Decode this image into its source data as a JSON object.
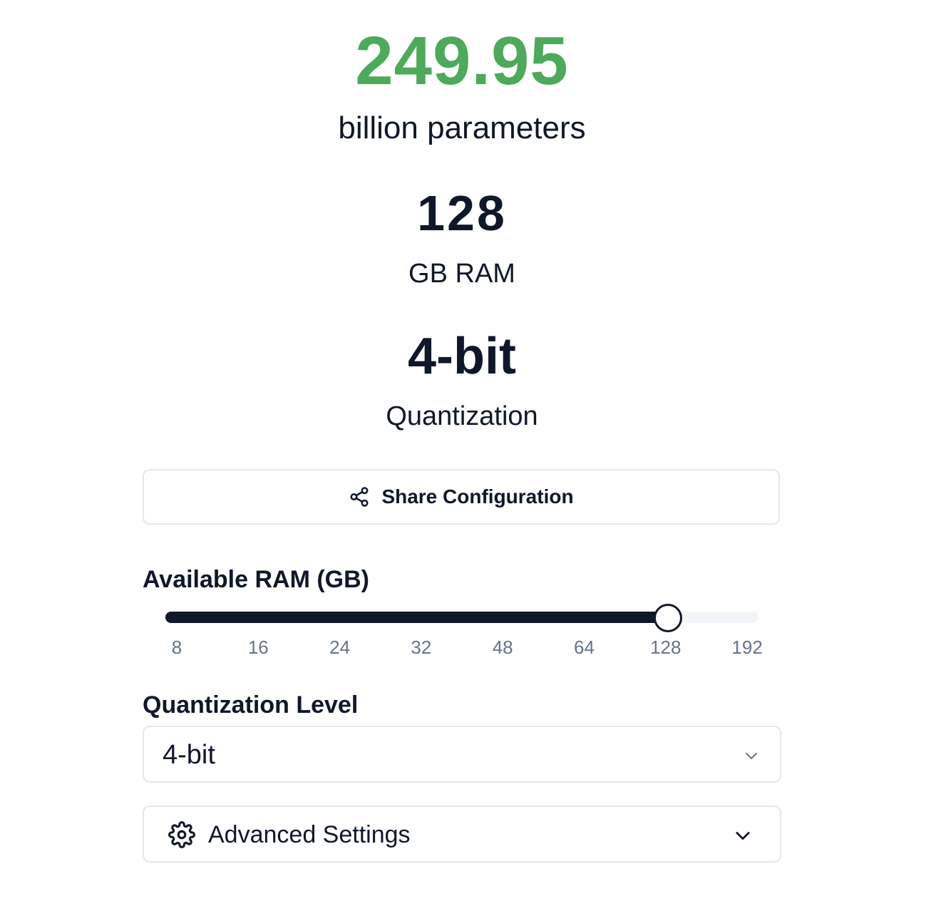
{
  "summary": {
    "parameters_value": "249.95",
    "parameters_caption": "billion parameters",
    "ram_value": "128",
    "ram_caption": "GB RAM",
    "quantization_value": "4-bit",
    "quantization_caption": "Quantization"
  },
  "share": {
    "label": "Share Configuration",
    "icon": "share-icon"
  },
  "ram_slider": {
    "label": "Available RAM (GB)",
    "ticks": [
      "8",
      "16",
      "24",
      "32",
      "48",
      "64",
      "128",
      "192"
    ],
    "selected": "128",
    "selected_index": 6
  },
  "quantization_select": {
    "label": "Quantization Level",
    "value": "4-bit",
    "icon": "chevron-down-icon"
  },
  "advanced": {
    "label": "Advanced Settings",
    "icon": "gear-icon",
    "chevron_icon": "chevron-down-icon"
  },
  "colors": {
    "accent_green": "#4caa5a",
    "text_dark": "#0f172a",
    "muted": "#64748b",
    "border": "#e2e8f0",
    "track": "#f1f5f9"
  }
}
